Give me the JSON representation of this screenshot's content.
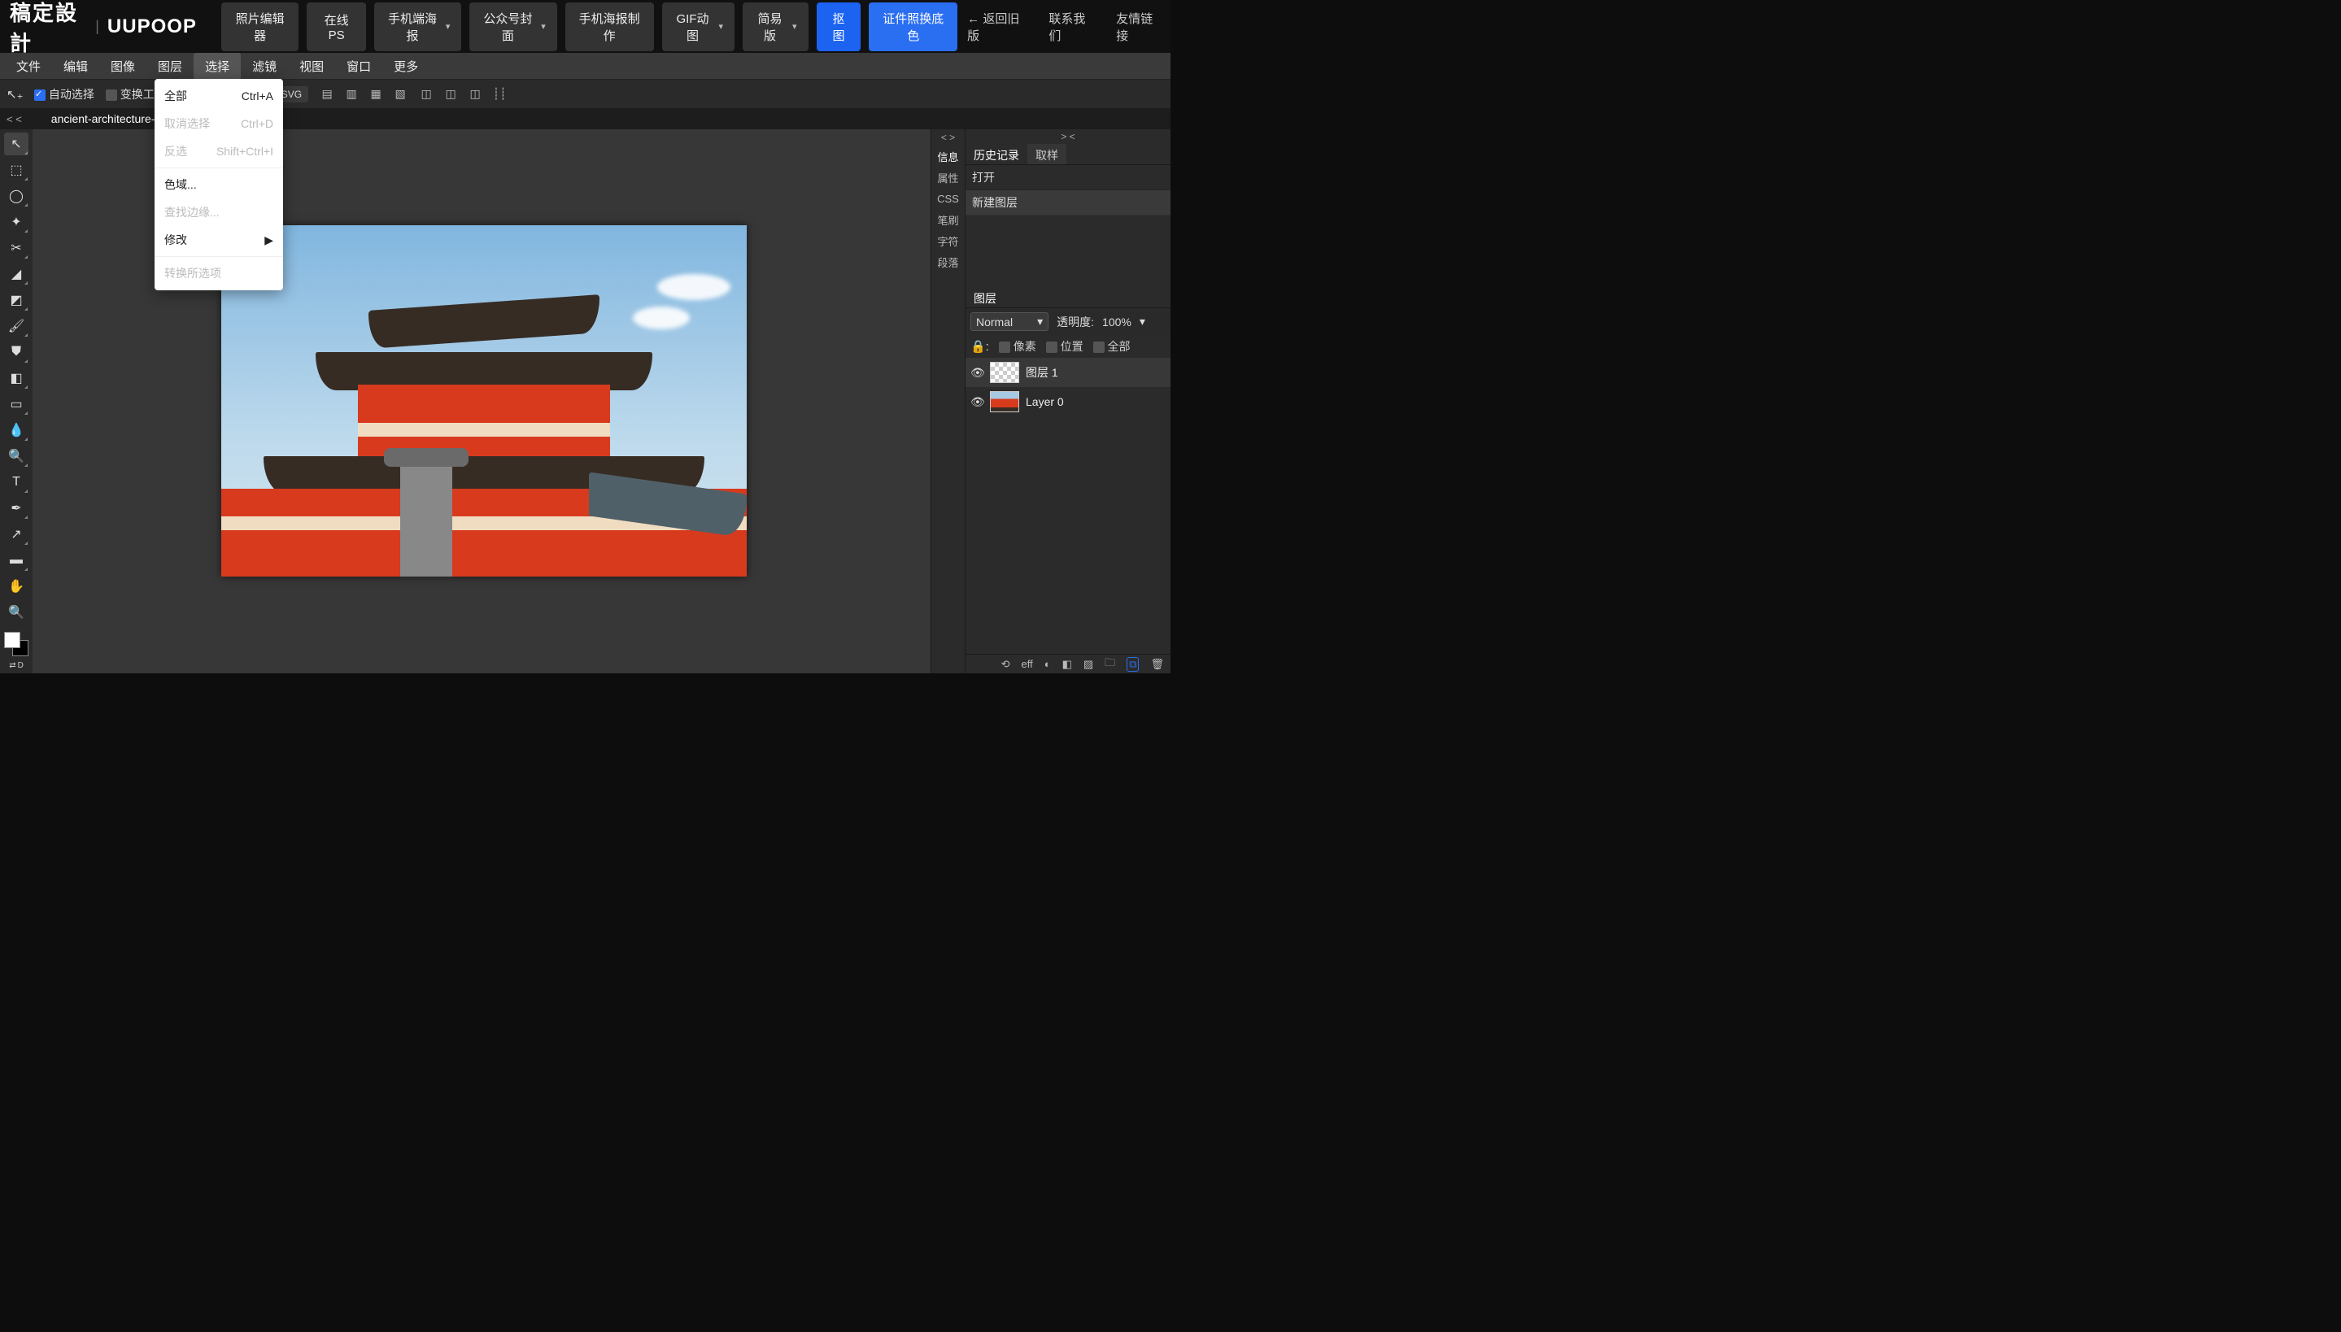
{
  "logo": {
    "cn": "稿定設計",
    "sep": "|",
    "en": "UUPOOP"
  },
  "topbuttons": [
    {
      "label": "照片编辑器",
      "caret": false
    },
    {
      "label": "在线PS",
      "caret": false
    },
    {
      "label": "手机端海报",
      "caret": true
    },
    {
      "label": "公众号封面",
      "caret": true
    },
    {
      "label": "手机海报制作",
      "caret": false
    },
    {
      "label": "GIF动图",
      "caret": true
    },
    {
      "label": "简易版",
      "caret": true
    }
  ],
  "topblue": [
    {
      "label": "抠图"
    },
    {
      "label": "证件照换底色"
    }
  ],
  "topright": {
    "back": "← 返回旧版",
    "contact": "联系我们",
    "links": "友情链接"
  },
  "menu": [
    "文件",
    "编辑",
    "图像",
    "图层",
    "选择",
    "滤镜",
    "视图",
    "窗口",
    "更多"
  ],
  "menu_active_index": 4,
  "optbar": {
    "auto": "自动选择",
    "trans": "变换工",
    "svg": "SVG"
  },
  "doc_chev": "< <",
  "doc_name": "ancient-architecture-a…",
  "right_chev_left": "< >",
  "right_chev_right": "> <",
  "right_labels": [
    "信息",
    "属性",
    "CSS",
    "笔刷",
    "字符",
    "段落"
  ],
  "history_tabs": [
    "历史记录",
    "取样"
  ],
  "history": [
    "打开",
    "新建图层"
  ],
  "layers_tab": "图层",
  "blend": {
    "mode": "Normal",
    "opacity_label": "透明度:",
    "opacity": "100%"
  },
  "lock": {
    "label_lock": "锁",
    "pixel": "像素",
    "pos": "位置",
    "all": "全部"
  },
  "layers": [
    {
      "name": "图层 1",
      "kind": "trans",
      "sel": true
    },
    {
      "name": "Layer 0",
      "kind": "img",
      "sel": false
    }
  ],
  "footer_icons": [
    "⟲",
    "eff",
    "◐",
    "◧",
    "▨",
    "🗀",
    "⧉",
    "🗑"
  ],
  "dropdown": [
    {
      "label": "全部",
      "short": "Ctrl+A",
      "enabled": true
    },
    {
      "label": "取消选择",
      "short": "Ctrl+D",
      "enabled": false
    },
    {
      "label": "反选",
      "short": "Shift+Ctrl+I",
      "enabled": false
    },
    {
      "sep": true
    },
    {
      "label": "色域...",
      "enabled": true
    },
    {
      "label": "查找边缘...",
      "enabled": false
    },
    {
      "label": "修改",
      "arrow": true,
      "enabled": true
    },
    {
      "sep": true
    },
    {
      "label": "转换所选项",
      "enabled": false
    }
  ]
}
